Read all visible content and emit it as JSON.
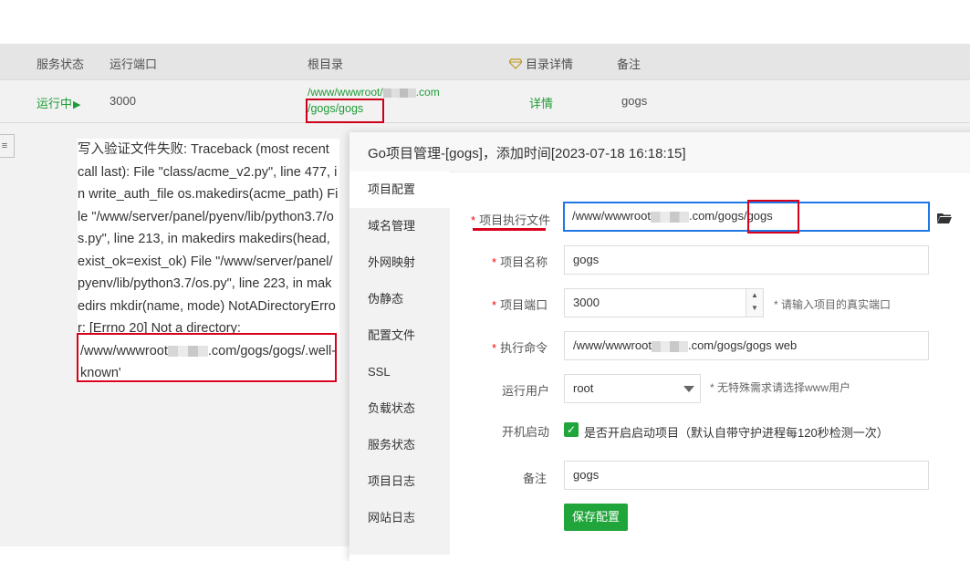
{
  "table": {
    "headers": {
      "status": "服务状态",
      "port": "运行端口",
      "root": "根目录",
      "details": "目录详情",
      "remark": "备注"
    },
    "row": {
      "status": "运行中",
      "port": "3000",
      "root_line1": "/www/wwwroot/",
      "root_line1_end": ".com",
      "root_line2": "/gogs/gogs",
      "details": "详情",
      "remark": "gogs"
    }
  },
  "error": {
    "message": "写入验证文件失败: Traceback (most recent call last): File \"class/acme_v2.py\", line 477, in write_auth_file os.makedirs(acme_path) File \"/www/server/panel/pyenv/lib/python3.7/os.py\", line 213, in makedirs makedirs(head, exist_ok=exist_ok) File \"/www/server/panel/pyenv/lib/python3.7/os.py\", line 223, in makedirs mkdir(name, mode) NotADirectoryError: [Errno 20] Not a directory:",
    "path_start": "/www/wwwroot",
    "path_end": ".com/gogs/gogs/.well-known'"
  },
  "dialog": {
    "title": "Go项目管理-[gogs]，添加时间[2023-07-18 16:18:15]",
    "menu": [
      "项目配置",
      "域名管理",
      "外网映射",
      "伪静态",
      "配置文件",
      "SSL",
      "负载状态",
      "服务状态",
      "项目日志",
      "网站日志"
    ],
    "form": {
      "exec_file_label": "项目执行文件",
      "exec_file_start": "/www/wwwroot",
      "exec_file_mid": ".com/gogs",
      "exec_file_end": "/gogs",
      "name_label": "项目名称",
      "name_value": "gogs",
      "port_label": "项目端口",
      "port_value": "3000",
      "port_hint": "* 请输入项目的真实端口",
      "cmd_label": "执行命令",
      "cmd_start": "/www/wwwroot",
      "cmd_end": ".com/gogs/gogs web",
      "user_label": "运行用户",
      "user_value": "root",
      "user_hint": "* 无特殊需求请选择www用户",
      "boot_label": "开机启动",
      "boot_text": "是否开启启动项目（默认自带守护进程每120秒检测一次）",
      "remark_label": "备注",
      "remark_value": "gogs",
      "save_label": "保存配置"
    }
  },
  "colors": {
    "accent": "#20a53a",
    "highlight": "#d9001b",
    "focus": "#1e78e6"
  }
}
